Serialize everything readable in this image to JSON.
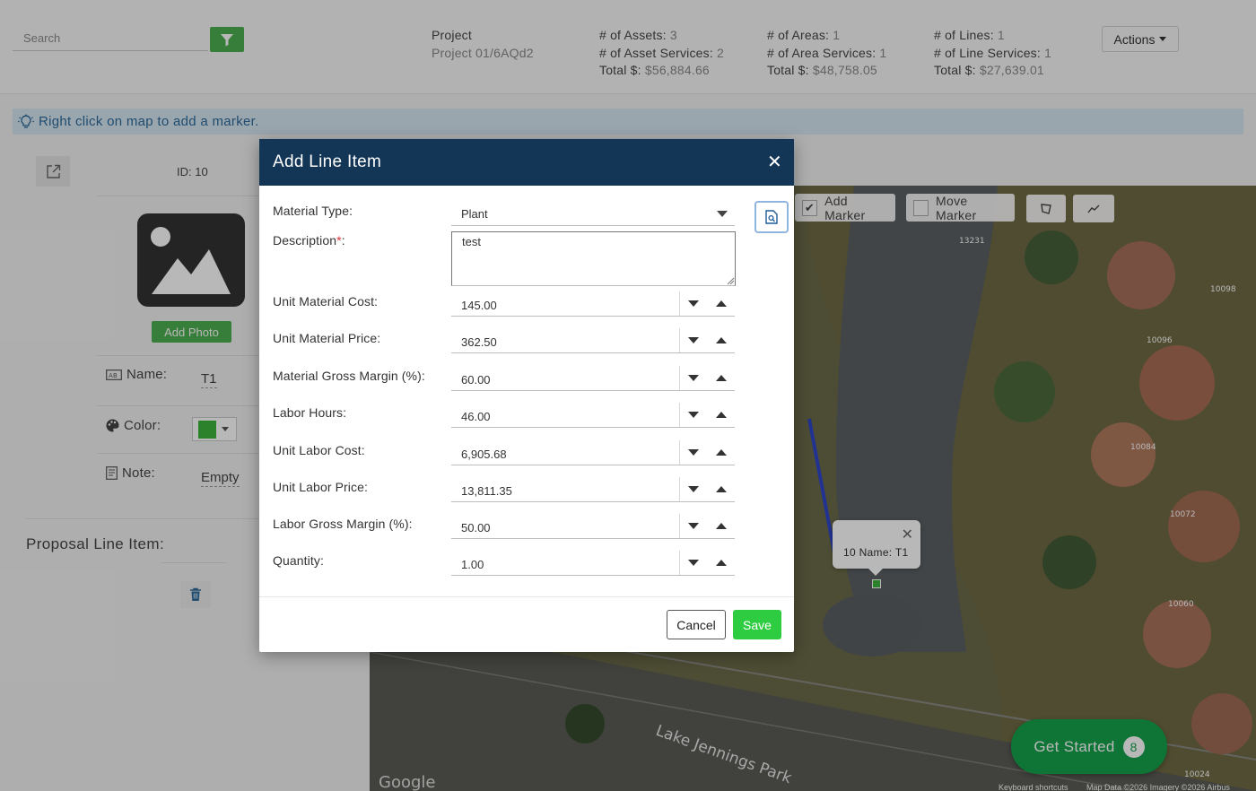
{
  "header": {
    "search_placeholder": "Search",
    "project": {
      "label": "Project",
      "value": "Project 01/6AQd2"
    },
    "assets": {
      "count_label": "# of Assets:",
      "count": "3",
      "services_label": "# of Asset Services:",
      "services": "2",
      "total_label": "Total $:",
      "total": "$56,884.66"
    },
    "areas": {
      "count_label": "# of Areas:",
      "count": "1",
      "services_label": "# of Area Services:",
      "services": "1",
      "total_label": "Total $:",
      "total": "$48,758.05"
    },
    "lines": {
      "count_label": "# of Lines:",
      "count": "1",
      "services_label": "# of Line Services:",
      "services": "1",
      "total_label": "Total $:",
      "total": "$27,639.01"
    },
    "actions_label": "Actions"
  },
  "infobar": {
    "text": "Right click on map to add a marker."
  },
  "leftpanel": {
    "id_text": "ID: 10",
    "add_photo_label": "Add Photo",
    "name_label": "Name:",
    "name_value": "T1",
    "color_label": "Color:",
    "color_value": "#3cb53c",
    "note_label": "Note:",
    "note_value": "Empty",
    "proposal_label": "Proposal Line Item:"
  },
  "map": {
    "add_marker_label": "Add Marker",
    "move_marker_label": "Move Marker",
    "popup_text": "10 Name: T1",
    "road_label": "Lake Jennings Park",
    "house_numbers": [
      "13231",
      "10098",
      "10096",
      "10084",
      "10072",
      "10060",
      "10024"
    ],
    "get_started_label": "Get Started",
    "get_started_count": "8",
    "google_label": "Google",
    "attribution_shortcuts": "Keyboard shortcuts",
    "attribution_data": "Map Data ©2026 Imagery ©2026 Airbus"
  },
  "modal": {
    "title": "Add Line Item",
    "material_type_label": "Material Type:",
    "material_type_value": "Plant",
    "description_label": "Description",
    "description_required": "*",
    "description_colon": ":",
    "description_value": "test",
    "fields": [
      {
        "label": "Unit Material Cost:",
        "value": "145.00"
      },
      {
        "label": "Unit Material Price:",
        "value": "362.50"
      },
      {
        "label": "Material Gross Margin (%):",
        "value": "60.00"
      },
      {
        "label": "Labor Hours:",
        "value": "46.00"
      },
      {
        "label": "Unit Labor Cost:",
        "value": "6,905.68"
      },
      {
        "label": "Unit Labor Price:",
        "value": "13,811.35"
      },
      {
        "label": "Labor Gross Margin (%):",
        "value": "50.00"
      },
      {
        "label": "Quantity:",
        "value": "1.00"
      }
    ],
    "cancel_label": "Cancel",
    "save_label": "Save"
  }
}
